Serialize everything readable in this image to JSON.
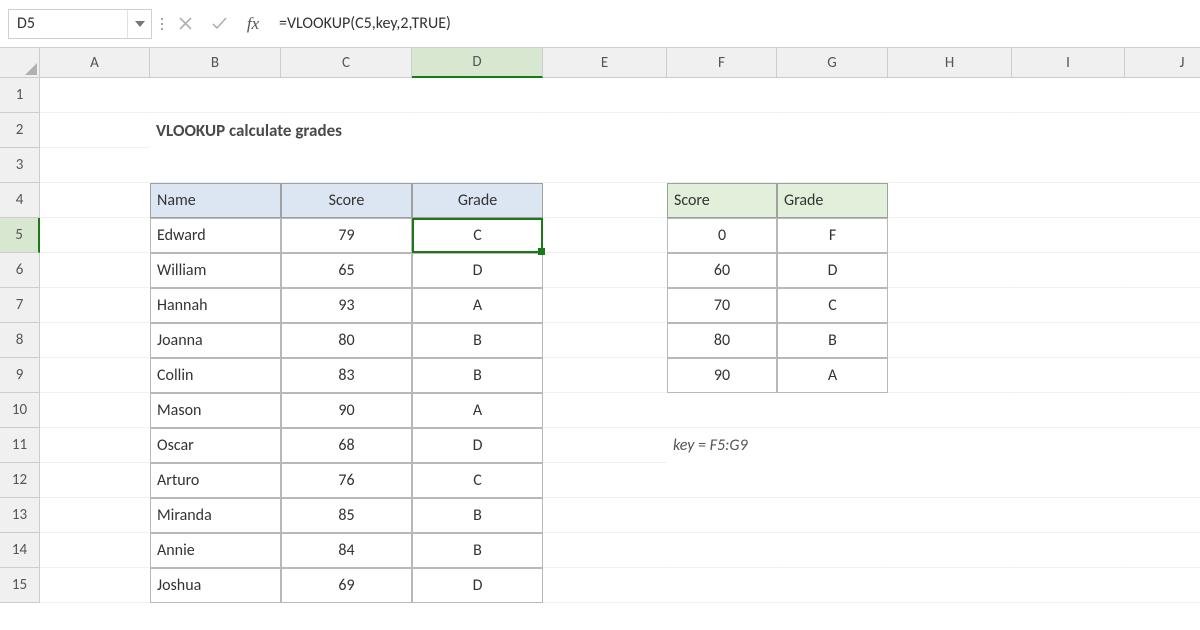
{
  "formula_bar": {
    "name_box": "D5",
    "fx_label": "fx",
    "formula": "=VLOOKUP(C5,key,2,TRUE)"
  },
  "columns": [
    "A",
    "B",
    "C",
    "D",
    "E",
    "F",
    "G",
    "H",
    "I",
    "J"
  ],
  "rows": [
    "1",
    "2",
    "3",
    "4",
    "5",
    "6",
    "7",
    "8",
    "9",
    "10",
    "11",
    "12",
    "13",
    "14",
    "15"
  ],
  "active_col": "D",
  "active_row": "5",
  "title": "VLOOKUP calculate grades",
  "grades_table": {
    "headers": {
      "name": "Name",
      "score": "Score",
      "grade": "Grade"
    },
    "rows": [
      {
        "name": "Edward",
        "score": "79",
        "grade": "C"
      },
      {
        "name": "William",
        "score": "65",
        "grade": "D"
      },
      {
        "name": "Hannah",
        "score": "93",
        "grade": "A"
      },
      {
        "name": "Joanna",
        "score": "80",
        "grade": "B"
      },
      {
        "name": "Collin",
        "score": "83",
        "grade": "B"
      },
      {
        "name": "Mason",
        "score": "90",
        "grade": "A"
      },
      {
        "name": "Oscar",
        "score": "68",
        "grade": "D"
      },
      {
        "name": "Arturo",
        "score": "76",
        "grade": "C"
      },
      {
        "name": "Miranda",
        "score": "85",
        "grade": "B"
      },
      {
        "name": "Annie",
        "score": "84",
        "grade": "B"
      },
      {
        "name": "Joshua",
        "score": "69",
        "grade": "D"
      }
    ]
  },
  "key_table": {
    "headers": {
      "score": "Score",
      "grade": "Grade"
    },
    "rows": [
      {
        "score": "0",
        "grade": "F"
      },
      {
        "score": "60",
        "grade": "D"
      },
      {
        "score": "70",
        "grade": "C"
      },
      {
        "score": "80",
        "grade": "B"
      },
      {
        "score": "90",
        "grade": "A"
      }
    ]
  },
  "note": "key = F5:G9"
}
